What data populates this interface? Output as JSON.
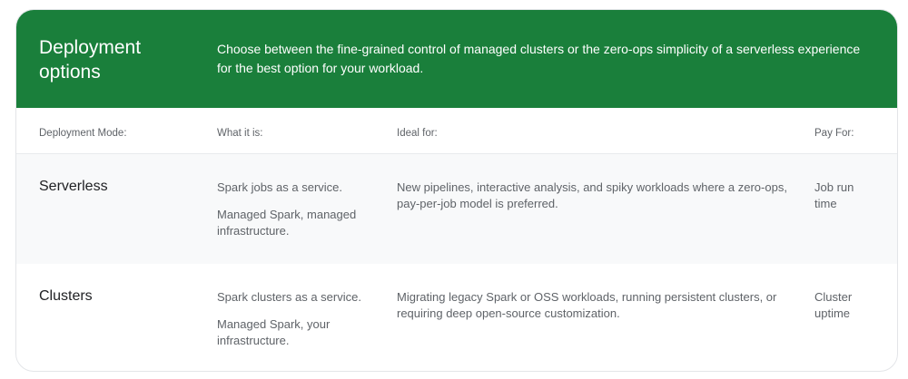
{
  "header": {
    "title": "Deployment options",
    "description": "Choose between the fine-grained control of managed clusters or the zero-ops simplicity of a serverless experience for the best option for your workload.",
    "color": "#1a7f3b"
  },
  "columns": [
    "Deployment Mode:",
    "What it is:",
    "Ideal for:",
    "Pay For:"
  ],
  "rows": [
    {
      "mode": "Serverless",
      "what": [
        "Spark jobs as a service.",
        "Managed Spark, managed infrastructure."
      ],
      "ideal": "New pipelines, interactive analysis, and spiky workloads where a zero-ops, pay-per-job model is preferred.",
      "pay": "Job run time"
    },
    {
      "mode": "Clusters",
      "what": [
        "Spark clusters as a service.",
        "Managed Spark, your infrastructure."
      ],
      "ideal": "Migrating legacy Spark or OSS workloads, running persistent clusters, or requiring deep open-source customization.",
      "pay": "Cluster uptime"
    }
  ]
}
